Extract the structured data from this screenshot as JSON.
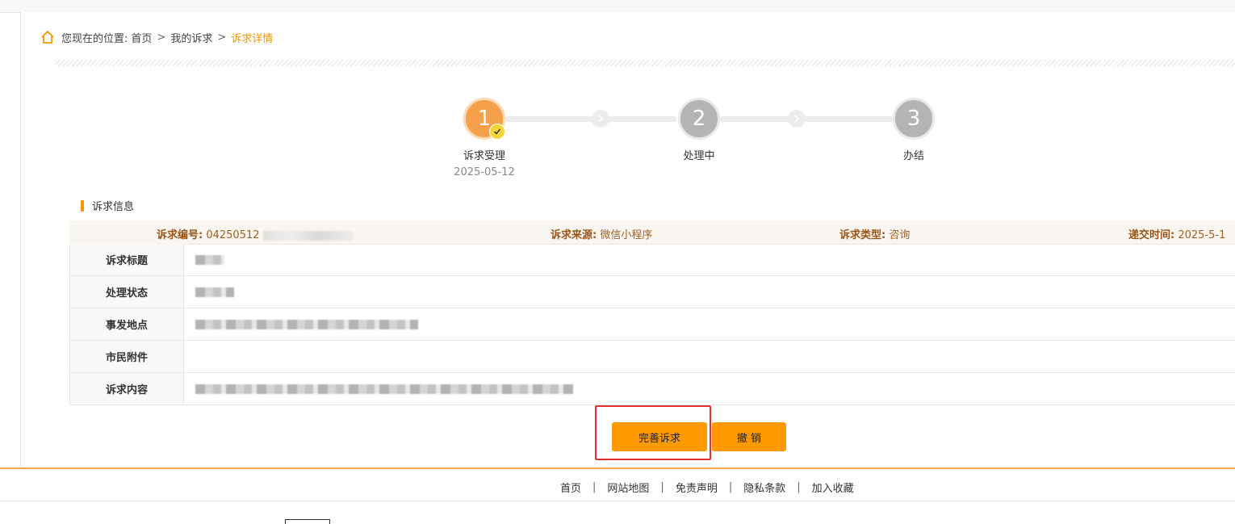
{
  "breadcrumb": {
    "prefix": "您现在的位置:",
    "items": [
      "首页",
      "我的诉求",
      "诉求详情"
    ],
    "separator": ">"
  },
  "steps": [
    {
      "number": "1",
      "label": "诉求受理",
      "date": "2025-05-12",
      "status": "done"
    },
    {
      "number": "2",
      "label": "处理中",
      "date": "",
      "status": "todo"
    },
    {
      "number": "3",
      "label": "办结",
      "date": "",
      "status": "todo"
    }
  ],
  "section": {
    "title": "诉求信息"
  },
  "meta": {
    "number_label": "诉求编号:",
    "number_value": "04250512",
    "source_label": "诉求来源:",
    "source_value": "微信小程序",
    "type_label": "诉求类型:",
    "type_value": "咨询",
    "time_label": "递交时间:",
    "time_value": "2025-5-1"
  },
  "details": [
    {
      "label": "诉求标题"
    },
    {
      "label": "处理状态"
    },
    {
      "label": "事发地点"
    },
    {
      "label": "市民附件"
    },
    {
      "label": "诉求内容"
    }
  ],
  "buttons": {
    "improve": "完善诉求",
    "cancel": "撤 销"
  },
  "footer": {
    "links": [
      "首页",
      "网站地图",
      "免责声明",
      "隐私条款",
      "加入收藏"
    ]
  },
  "colors": {
    "accent": "#ff9900",
    "highlight_box": "#e53030"
  }
}
